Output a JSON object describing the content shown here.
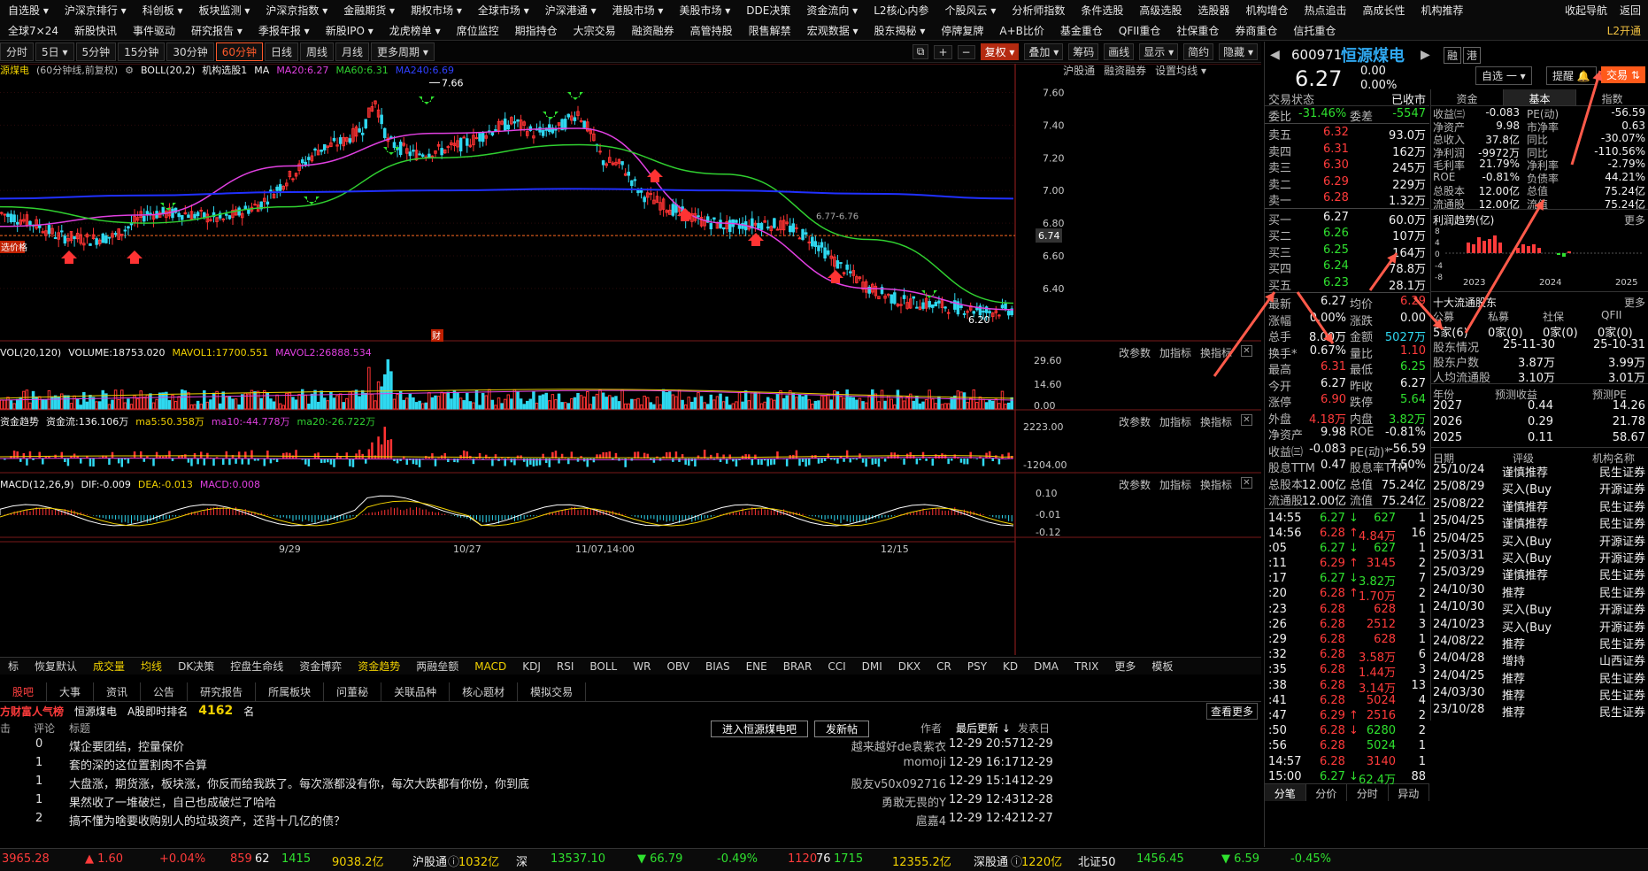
{
  "menu": {
    "row1": [
      "自选股 ▾",
      "沪深京排行 ▾",
      "科创板 ▾",
      "板块监测 ▾",
      "沪深京指数 ▾",
      "金融期货 ▾",
      "期权市场 ▾",
      "全球市场 ▾",
      "沪深港通 ▾",
      "港股市场 ▾",
      "美股市场 ▾",
      "DDE决策",
      "资金流向 ▾",
      "L2核心内参",
      "个股风云 ▾",
      "分析师指数",
      "条件选股",
      "高级选股",
      "选股器",
      "机构增仓",
      "热点追击",
      "高成长性",
      "机构推荐"
    ],
    "row2": [
      "全球7×24",
      "新股快讯",
      "事件驱动",
      "研究报告 ▾",
      "季报年报 ▾",
      "新股IPO ▾",
      "龙虎榜单 ▾",
      "席位监控",
      "期指持仓",
      "大宗交易",
      "融资融券",
      "高管持股",
      "限售解禁",
      "宏观数据 ▾",
      "股东揭秘 ▾",
      "停牌复牌",
      "A+B比价",
      "基金重仓",
      "QFII重仓",
      "社保重仓",
      "券商重仓",
      "信托重仓"
    ],
    "right_row1": [
      "收起导航",
      "返回"
    ],
    "right_row2": [
      "L2开通"
    ]
  },
  "periods": [
    "分时",
    "5日 ▾",
    "5分钟",
    "15分钟",
    "30分钟",
    "60分钟",
    "日线",
    "周线",
    "月线",
    "更多周期 ▾"
  ],
  "active_period": "60分钟",
  "toolbar_right": [
    "复权 ▾",
    "叠加 ▾",
    "筹码",
    "画线",
    "显示 ▾",
    "简约",
    "隐藏 ▾"
  ],
  "main_chart": {
    "header_prefix": "源煤电",
    "header_mode": "(60分钟线,前复权)",
    "boll": "BOLL(20,2)",
    "signal": "机构选股1",
    "ma_label": "MA",
    "ma20": "MA20:6.27",
    "ma60": "MA60:6.31",
    "ma240": "MA240:6.69",
    "right_links": [
      "沪股通",
      "融资融券",
      "设置均线 ▾"
    ],
    "y_ticks": [
      "7.60",
      "7.40",
      "7.20",
      "7.00",
      "6.80",
      "6.60",
      "6.40"
    ],
    "current_price_tag": "6.74",
    "high_label": "7.66",
    "low_label": "6.20",
    "channel_label": "6.77-6.76",
    "left_tag": "选价格",
    "cai_tag": "财"
  },
  "vol_panel": {
    "label": "VOL(20,120)",
    "volume": "VOLUME:18753.020",
    "mavol1": "MAVOL1:17700.551",
    "mavol2": "MAVOL2:26888.534",
    "y_ticks": [
      "29.60",
      "14.60",
      "0.00"
    ],
    "right": [
      "改参数",
      "加指标",
      "换指标"
    ]
  },
  "fund_panel": {
    "label": "资金趋势",
    "flow": "资金流:136.106万",
    "ma5": "ma5:50.358万",
    "ma10": "ma10:-44.778万",
    "ma20": "ma20:-26.722万",
    "y_ticks": [
      "2223.00",
      "-1204.00"
    ],
    "right": [
      "改参数",
      "加指标",
      "换指标"
    ]
  },
  "macd_panel": {
    "label": "MACD(12,26,9)",
    "dif": "DIF:-0.009",
    "dea": "DEA:-0.013",
    "macd": "MACD:0.008",
    "y_ticks": [
      "0.10",
      "-0.01",
      "-0.12"
    ],
    "right": [
      "改参数",
      "加指标",
      "换指标"
    ]
  },
  "x_axis": [
    "9/29",
    "10/27",
    "11/07,14:00",
    "12/15"
  ],
  "indicator_tabs": [
    "标",
    "恢复默认",
    "成交量",
    "均线",
    "DK决策",
    "控盘生命线",
    "资金博弈",
    "资金趋势",
    "两融垒额",
    "MACD",
    "KDJ",
    "RSI",
    "BOLL",
    "WR",
    "OBV",
    "BIAS",
    "ENE",
    "BRAR",
    "CCI",
    "DMI",
    "DKX",
    "CR",
    "PSY",
    "KD",
    "DMA",
    "TRIX",
    "更多",
    "模板"
  ],
  "indicator_active": [
    "成交量",
    "均线",
    "资金趋势",
    "MACD"
  ],
  "news": {
    "tabs": [
      "股吧",
      "大事",
      "资讯",
      "公告",
      "研究报告",
      "所属板块",
      "问董秘",
      "关联品种",
      "核心题材",
      "模拟交易"
    ],
    "rank_title": "方财富人气榜",
    "rank_stock": "恒源煤电",
    "rank_label": "A股即时排名",
    "rank_value": "4162",
    "rank_unit": "名",
    "more": "查看更多",
    "cols": [
      "击",
      "评论",
      "标题",
      "作者",
      "最后更新 ↓",
      "发表日"
    ],
    "btn_enter": "进入恒源煤电吧",
    "btn_post": "发新帖",
    "rows": [
      {
        "c1": "",
        "c2": "0",
        "title": "煤企要团结，控量保价",
        "author": "越来越好de袁紫衣",
        "updated": "12-29  20:57",
        "posted": "12-29"
      },
      {
        "c1": "",
        "c2": "1",
        "title": "套的深的这位置割肉不合算",
        "author": "momoji",
        "updated": "12-29  16:17",
        "posted": "12-29"
      },
      {
        "c1": "",
        "c2": "1",
        "title": "大盘涨，期货涨，板块涨，你反而给我跌了。每次涨都没有你，每次大跌都有你份，你到底",
        "author": "股友v50x092716",
        "updated": "12-29  15:14",
        "posted": "12-29"
      },
      {
        "c1": "",
        "c2": "1",
        "title": "果然收了一堆破烂，自己也成破烂了哈哈",
        "author": "勇敢无畏的Y",
        "updated": "12-29  12:43",
        "posted": "12-28"
      },
      {
        "c1": "",
        "c2": "2",
        "title": "搞不懂为啥要收购别人的垃圾资产，还背十几亿的债？",
        "author": "扈嘉4",
        "updated": "12-29  12:42",
        "posted": "12-27"
      }
    ]
  },
  "status": {
    "sh_index": "3965.28",
    "sh_change": "▲ 1.60",
    "sh_pct": "+0.04%",
    "sh_up": "859",
    "sh_flat": "62",
    "sh_down": "1415",
    "sh_amt": "9038.2亿",
    "hgt_label": "沪股通",
    "hgt_val": "1032亿",
    "sz_label": "深",
    "sz_index": "13537.10",
    "sz_change": "▼ 66.79",
    "sz_pct": "-0.49%",
    "sz_up": "1120",
    "sz_flat": "76",
    "sz_down": "1715",
    "sz_amt": "12355.2亿",
    "sgt_label": "深股通",
    "sgt_val": "1220亿",
    "bz_label": "北证50",
    "bz_index": "1456.45",
    "bz_change": "▼ 6.59",
    "bz_pct": "-0.45%"
  },
  "quote": {
    "code": "600971",
    "name": "恒源煤电",
    "badge1": "融",
    "badge2": "港",
    "price": "6.27",
    "change": "0.00",
    "pct": "0.00%",
    "btn_zixuan": "自选 一 ▾",
    "btn_tixing": "提醒 🔔",
    "btn_trade": "交易 ⇅",
    "state_label": "交易状态",
    "state_value": "已收市",
    "weibi_label": "委比",
    "weibi": "-31.46%",
    "weicha_label": "委差",
    "weicha": "-5547",
    "sells": [
      {
        "label": "卖五",
        "price": "6.32",
        "vol": "93.0万"
      },
      {
        "label": "卖四",
        "price": "6.31",
        "vol": "162万"
      },
      {
        "label": "卖三",
        "price": "6.30",
        "vol": "245万"
      },
      {
        "label": "卖二",
        "price": "6.29",
        "vol": "229万"
      },
      {
        "label": "卖一",
        "price": "6.28",
        "vol": "1.32万"
      }
    ],
    "buys": [
      {
        "label": "买一",
        "price": "6.27",
        "vol": "60.0万"
      },
      {
        "label": "买二",
        "price": "6.26",
        "vol": "107万"
      },
      {
        "label": "买三",
        "price": "6.25",
        "vol": "164万"
      },
      {
        "label": "买四",
        "price": "6.24",
        "vol": "78.8万"
      },
      {
        "label": "买五",
        "price": "6.23",
        "vol": "28.1万"
      }
    ],
    "stats": [
      {
        "l1": "最新",
        "v1": "6.27",
        "c1": "white",
        "l2": "均价",
        "v2": "6.29",
        "c2": "red"
      },
      {
        "l1": "涨幅",
        "v1": "0.00%",
        "c1": "white",
        "l2": "涨跌",
        "v2": "0.00",
        "c2": "white"
      },
      {
        "l1": "总手",
        "v1": "8.00万",
        "c1": "white",
        "l2": "金额",
        "v2": "5027万",
        "c2": "cyan"
      },
      {
        "l1": "换手*",
        "v1": "0.67%",
        "c1": "white",
        "l2": "量比",
        "v2": "1.10",
        "c2": "red"
      },
      {
        "l1": "最高",
        "v1": "6.31",
        "c1": "red",
        "l2": "最低",
        "v2": "6.25",
        "c2": "green"
      },
      {
        "l1": "今开",
        "v1": "6.27",
        "c1": "white",
        "l2": "昨收",
        "v2": "6.27",
        "c2": "white"
      },
      {
        "l1": "涨停",
        "v1": "6.90",
        "c1": "red",
        "l2": "跌停",
        "v2": "5.64",
        "c2": "green"
      },
      {
        "l1": "外盘",
        "v1": "4.18万",
        "c1": "red",
        "l2": "内盘",
        "v2": "3.82万",
        "c2": "green"
      },
      {
        "l1": "净资产",
        "v1": "9.98",
        "c1": "white",
        "l2": "ROE",
        "v2": "-0.81%",
        "c2": "white"
      },
      {
        "l1": "收益㈢",
        "v1": "-0.083",
        "c1": "white",
        "l2": "PE(动)*",
        "v2": "-56.59",
        "c2": "white"
      },
      {
        "l1": "股息TTM",
        "v1": "0.47",
        "c1": "white",
        "l2": "股息率TTM",
        "v2": "7.50%",
        "c2": "white"
      },
      {
        "l1": "总股本",
        "v1": "12.00亿",
        "c1": "white",
        "l2": "总值",
        "v2": "75.24亿",
        "c2": "white"
      },
      {
        "l1": "流通股",
        "v1": "12.00亿",
        "c1": "white",
        "l2": "流值",
        "v2": "75.24亿",
        "c2": "white"
      }
    ],
    "ticks": [
      {
        "t": "14:55",
        "p": "6.27",
        "arrow": "↓",
        "pc": "green",
        "v": "627",
        "vc": "green",
        "n": "1"
      },
      {
        "t": "14:56",
        "p": "6.28",
        "arrow": "↑",
        "pc": "red",
        "v": "4.84万",
        "vc": "red",
        "n": "16"
      },
      {
        "t": ":05",
        "p": "6.27",
        "arrow": "↓",
        "pc": "green",
        "v": "627",
        "vc": "green",
        "n": "1"
      },
      {
        "t": ":11",
        "p": "6.29",
        "arrow": "↑",
        "pc": "red",
        "v": "3145",
        "vc": "red",
        "n": "2"
      },
      {
        "t": ":17",
        "p": "6.27",
        "arrow": "↓",
        "pc": "green",
        "v": "3.82万",
        "vc": "green",
        "n": "7"
      },
      {
        "t": ":20",
        "p": "6.28",
        "arrow": "↑",
        "pc": "red",
        "v": "1.70万",
        "vc": "red",
        "n": "2"
      },
      {
        "t": ":23",
        "p": "6.28",
        "arrow": "",
        "pc": "red",
        "v": "628",
        "vc": "red",
        "n": "1"
      },
      {
        "t": ":26",
        "p": "6.28",
        "arrow": "",
        "pc": "red",
        "v": "2512",
        "vc": "red",
        "n": "3"
      },
      {
        "t": ":29",
        "p": "6.28",
        "arrow": "",
        "pc": "red",
        "v": "628",
        "vc": "red",
        "n": "1"
      },
      {
        "t": ":32",
        "p": "6.28",
        "arrow": "",
        "pc": "red",
        "v": "3.58万",
        "vc": "red",
        "n": "6"
      },
      {
        "t": ":35",
        "p": "6.28",
        "arrow": "",
        "pc": "red",
        "v": "1.44万",
        "vc": "red",
        "n": "3"
      },
      {
        "t": ":38",
        "p": "6.28",
        "arrow": "",
        "pc": "red",
        "v": "3.14万",
        "vc": "red",
        "n": "13"
      },
      {
        "t": ":41",
        "p": "6.28",
        "arrow": "",
        "pc": "red",
        "v": "5024",
        "vc": "red",
        "n": "4"
      },
      {
        "t": ":47",
        "p": "6.29",
        "arrow": "↑",
        "pc": "red",
        "v": "2516",
        "vc": "red",
        "n": "2"
      },
      {
        "t": ":50",
        "p": "6.28",
        "arrow": "↓",
        "pc": "red",
        "v": "6280",
        "vc": "green",
        "n": "2"
      },
      {
        "t": ":56",
        "p": "6.28",
        "arrow": "",
        "pc": "red",
        "v": "5024",
        "vc": "green",
        "n": "1"
      },
      {
        "t": "14:57",
        "p": "6.28",
        "arrow": "",
        "pc": "red",
        "v": "3140",
        "vc": "red",
        "n": "1"
      },
      {
        "t": "15:00",
        "p": "6.27",
        "arrow": "↓",
        "pc": "green",
        "v": "62.4万",
        "vc": "green",
        "n": "88"
      }
    ],
    "bottom_tabs": [
      "分笔",
      "分价",
      "分时",
      "异动"
    ]
  },
  "fin": {
    "tabs": [
      "资金",
      "基本",
      "指数"
    ],
    "rows": [
      {
        "l1": "收益㈢",
        "v1": "-0.083",
        "l2": "PE(动)",
        "v2": "-56.59"
      },
      {
        "l1": "净资产",
        "v1": "9.98",
        "l2": "市净率",
        "v2": "0.63"
      },
      {
        "l1": "总收入",
        "v1": "37.8亿",
        "l2": "同比",
        "v2": "-30.07%"
      },
      {
        "l1": "净利润",
        "v1": "-9972万",
        "l2": "同比",
        "v2": "-110.56%"
      },
      {
        "l1": "毛利率",
        "v1": "21.79%",
        "l2": "净利率",
        "v2": "-2.79%"
      },
      {
        "l1": "ROE",
        "v1": "-0.81%",
        "l2": "负债率",
        "v2": "44.21%"
      },
      {
        "l1": "总股本",
        "v1": "12.00亿",
        "l2": "总值",
        "v2": "75.24亿"
      },
      {
        "l1": "流通股",
        "v1": "12.00亿",
        "l2": "流值",
        "v2": "75.24亿"
      }
    ],
    "profit_title": "利润趋势(亿)",
    "more": "更多",
    "profit_y": [
      "8",
      "4",
      "0",
      "-4",
      "-8"
    ],
    "profit_years": [
      "2023",
      "2024",
      "2025"
    ],
    "holders_title": "十大流通股东",
    "holders_cols": [
      "公募",
      "私募",
      "社保",
      "QFII"
    ],
    "holders_vals": [
      "5家(6)",
      "0家(0)",
      "0家(0)",
      "0家(0)"
    ],
    "holder_stats": [
      {
        "l": "股东情况",
        "a": "25-11-30",
        "b": "25-10-31"
      },
      {
        "l": "股东户数",
        "a": "3.87万",
        "b": "3.99万"
      },
      {
        "l": "人均流通股",
        "a": "3.10万",
        "b": "3.01万"
      }
    ],
    "forecast_cols": [
      "年份",
      "预测收益",
      "预测PE"
    ],
    "forecast": [
      {
        "y": "2027",
        "e": "0.44",
        "pe": "14.26"
      },
      {
        "y": "2026",
        "e": "0.29",
        "pe": "21.78"
      },
      {
        "y": "2025",
        "e": "0.11",
        "pe": "58.67"
      }
    ],
    "rating_cols": [
      "日期",
      "评级",
      "机构名称"
    ],
    "ratings": [
      {
        "d": "25/10/24",
        "r": "谨慎推荐",
        "o": "民生证券"
      },
      {
        "d": "25/08/29",
        "r": "买入(Buy",
        "o": "开源证券"
      },
      {
        "d": "25/08/22",
        "r": "谨慎推荐",
        "o": "民生证券"
      },
      {
        "d": "25/04/25",
        "r": "谨慎推荐",
        "o": "民生证券"
      },
      {
        "d": "25/04/25",
        "r": "买入(Buy",
        "o": "开源证券"
      },
      {
        "d": "25/03/31",
        "r": "买入(Buy",
        "o": "开源证券"
      },
      {
        "d": "25/03/29",
        "r": "谨慎推荐",
        "o": "民生证券"
      },
      {
        "d": "24/10/30",
        "r": "推荐",
        "o": "民生证券"
      },
      {
        "d": "24/10/30",
        "r": "买入(Buy",
        "o": "开源证券"
      },
      {
        "d": "24/10/23",
        "r": "买入(Buy",
        "o": "开源证券"
      },
      {
        "d": "24/08/22",
        "r": "推荐",
        "o": "民生证券"
      },
      {
        "d": "24/04/28",
        "r": "增持",
        "o": "山西证券"
      },
      {
        "d": "24/04/25",
        "r": "推荐",
        "o": "民生证券"
      },
      {
        "d": "24/03/30",
        "r": "推荐",
        "o": "民生证券"
      },
      {
        "d": "23/10/28",
        "r": "推荐",
        "o": "民生证券"
      }
    ]
  },
  "chart_data": {
    "type": "line",
    "title": "",
    "xlabel": "",
    "ylabel": "",
    "x": [
      "9/29",
      "10/27",
      "11/07,14:00",
      "12/15"
    ],
    "series": [
      {
        "name": "MA20",
        "values": [
          6.78,
          6.85,
          7.15,
          7.35,
          7.38,
          6.8,
          6.4,
          6.27
        ]
      },
      {
        "name": "MA60",
        "values": [
          6.9,
          6.8,
          6.9,
          7.2,
          7.28,
          7.1,
          6.7,
          6.31
        ]
      },
      {
        "name": "MA240",
        "values": [
          6.95,
          6.97,
          6.99,
          7.0,
          7.01,
          7.0,
          6.98,
          6.95
        ]
      }
    ],
    "ylim": [
      6.15,
      7.7
    ],
    "high": 7.66,
    "low": 6.2,
    "colors": {
      "up": "#ff3333",
      "down": "#2fd8f0",
      "ma20": "#e040e0",
      "ma60": "#30d030",
      "ma240": "#2030ff"
    }
  }
}
